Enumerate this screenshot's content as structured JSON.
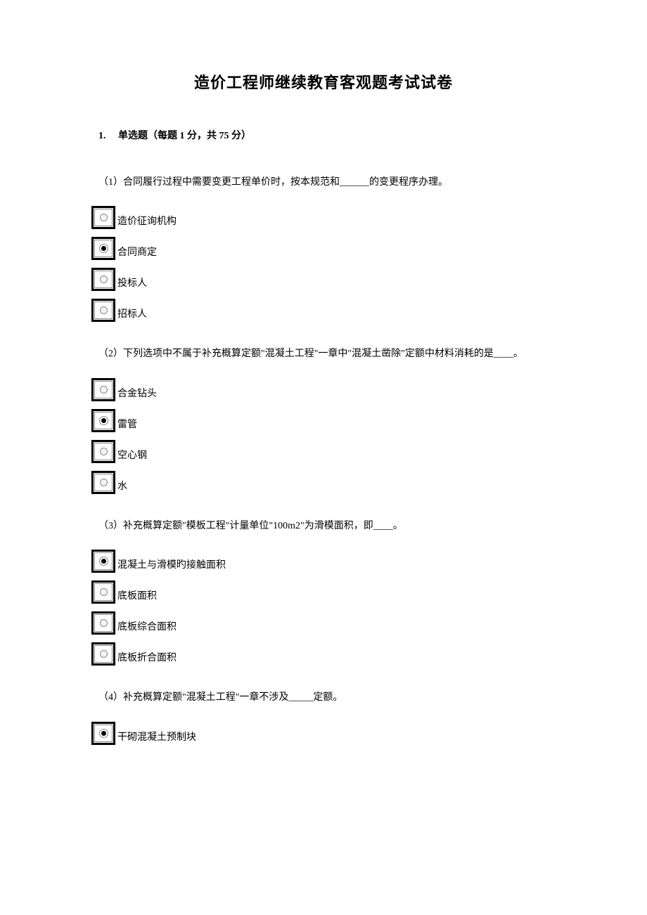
{
  "title": "造价工程师继续教育客观题考试试卷",
  "section": {
    "number": "1.",
    "label": "单选题（每题 1 分，共 75 分）"
  },
  "questions": [
    {
      "text": "（1）合同履行过程中需要变更工程单价时，按本规范和______的变更程序办理。",
      "options": [
        {
          "label": "造价征询机构",
          "selected": false
        },
        {
          "label": "合同商定",
          "selected": true
        },
        {
          "label": "投标人",
          "selected": false
        },
        {
          "label": "招标人",
          "selected": false
        }
      ]
    },
    {
      "text": "（2）下列选项中不属于补充概算定额\"混凝土工程\"一章中\"混凝土凿除\"定额中材料消耗的是____。",
      "options": [
        {
          "label": "合金钻头",
          "selected": false
        },
        {
          "label": "雷管",
          "selected": true
        },
        {
          "label": "空心钢",
          "selected": false
        },
        {
          "label": "水",
          "selected": false
        }
      ]
    },
    {
      "text": "（3）补充概算定额\"模板工程\"计量单位\"100m2\"为滑模面积，即____。",
      "options": [
        {
          "label": "混凝土与滑模旳接触面积",
          "selected": true
        },
        {
          "label": "底板面积",
          "selected": false
        },
        {
          "label": "底板综合面积",
          "selected": false
        },
        {
          "label": "底板折合面积",
          "selected": false
        }
      ]
    },
    {
      "text": "（4）补充概算定额\"混凝土工程\"一章不涉及_____定额。",
      "options": [
        {
          "label": "干砌混凝土预制块",
          "selected": true
        }
      ]
    }
  ]
}
